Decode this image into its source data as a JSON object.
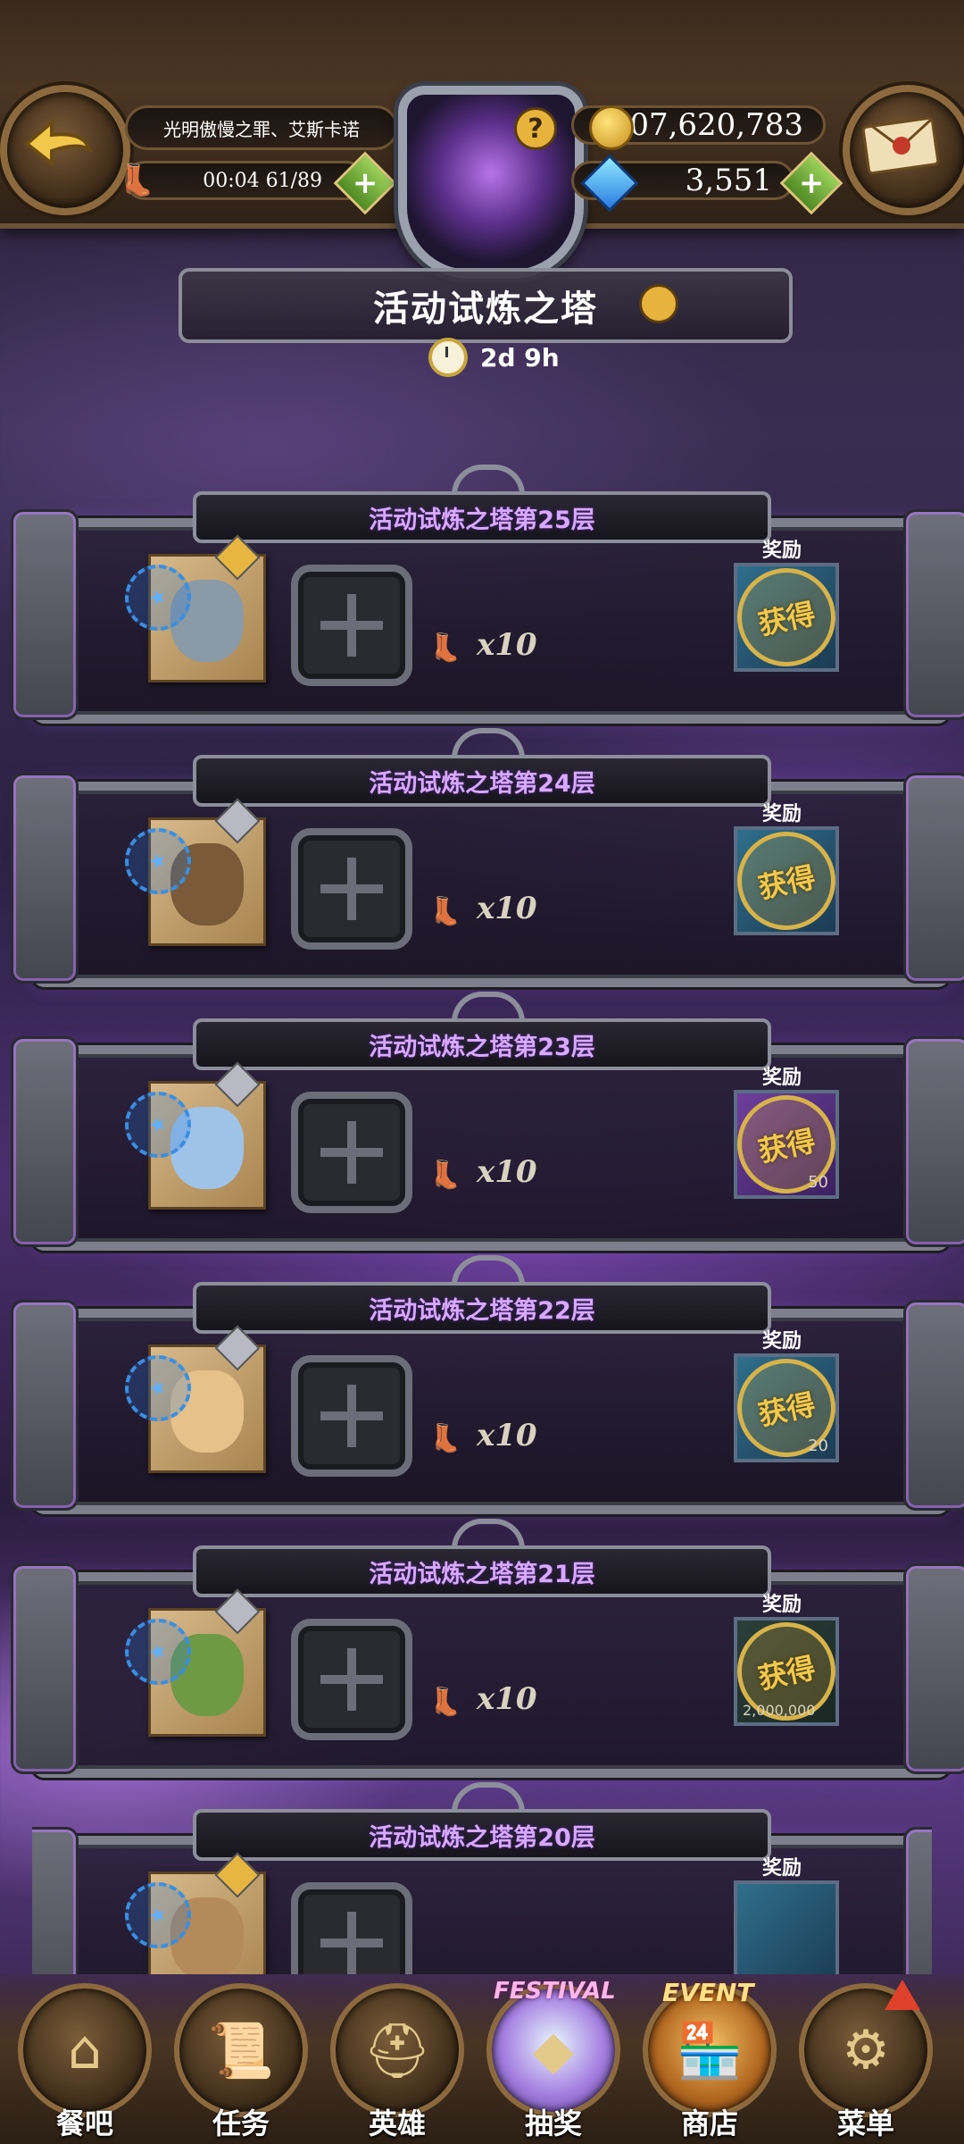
{
  "header": {
    "team_name": "光明傲慢之罪、艾斯卡诺",
    "stamina": "00:04 61/89",
    "gold": "207,620,783",
    "gems": "3,551",
    "plus": "+",
    "help": "?"
  },
  "tower": {
    "title": "活动试炼之塔",
    "timer": "2d 9h"
  },
  "floors": [
    {
      "title": "活动试炼之塔第25层",
      "cost": "x10",
      "reward_label": "奖励",
      "status": "获得"
    },
    {
      "title": "活动试炼之塔第24层",
      "cost": "x10",
      "reward_label": "奖励",
      "status": "获得"
    },
    {
      "title": "活动试炼之塔第23层",
      "cost": "x10",
      "reward_label": "奖励",
      "status": "获得",
      "amount": "50"
    },
    {
      "title": "活动试炼之塔第22层",
      "cost": "x10",
      "reward_label": "奖励",
      "status": "获得",
      "amount": "20"
    },
    {
      "title": "活动试炼之塔第21层",
      "cost": "x10",
      "reward_label": "奖励",
      "status": "获得",
      "amount": "2,000,000"
    },
    {
      "title": "活动试炼之塔第20层",
      "cost": "",
      "reward_label": "奖励",
      "status": ""
    }
  ],
  "nav": {
    "items": [
      {
        "label": "餐吧",
        "icon": "tavern-icon"
      },
      {
        "label": "任务",
        "icon": "scroll-icon"
      },
      {
        "label": "英雄",
        "icon": "helmet-icon"
      },
      {
        "label": "抽奖",
        "icon": "festival-gem-icon",
        "tag": "FESTIVAL"
      },
      {
        "label": "商店",
        "icon": "event-shop-icon",
        "tag": "EVENT"
      },
      {
        "label": "菜单",
        "icon": "gear-icon"
      }
    ]
  },
  "colors": {
    "accent_purple": "#d7a9ff",
    "gold": "#f1c94d",
    "frame": "#7d808c"
  }
}
